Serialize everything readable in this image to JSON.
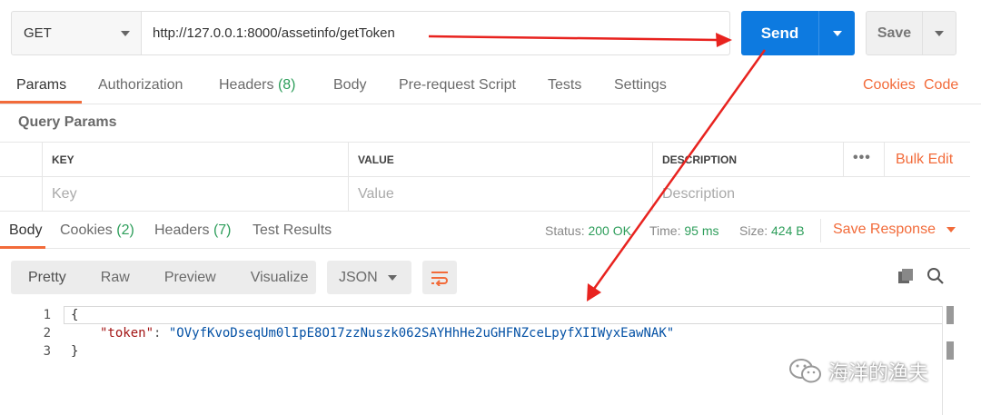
{
  "request": {
    "method": "GET",
    "url": "http://127.0.0.1:8000/assetinfo/getToken",
    "send_label": "Send",
    "save_label": "Save"
  },
  "request_tabs": {
    "params": "Params",
    "authorization": "Authorization",
    "headers": "Headers",
    "headers_count": "(8)",
    "body": "Body",
    "pre_request": "Pre-request Script",
    "tests": "Tests",
    "settings": "Settings",
    "cookies": "Cookies",
    "code": "Code"
  },
  "query_params": {
    "title": "Query Params",
    "columns": [
      "KEY",
      "VALUE",
      "DESCRIPTION"
    ],
    "placeholders": [
      "Key",
      "Value",
      "Description"
    ],
    "more": "•••",
    "bulk_edit": "Bulk Edit"
  },
  "response_tabs": {
    "body": "Body",
    "cookies": "Cookies",
    "cookies_count": "(2)",
    "headers": "Headers",
    "headers_count": "(7)",
    "test_results": "Test Results",
    "status_label": "Status:",
    "status_value": "200 OK",
    "time_label": "Time:",
    "time_value": "95 ms",
    "size_label": "Size:",
    "size_value": "424 B",
    "save_response": "Save Response"
  },
  "format_bar": {
    "pretty": "Pretty",
    "raw": "Raw",
    "preview": "Preview",
    "visualize": "Visualize",
    "format": "JSON"
  },
  "code": {
    "line_numbers": [
      "1",
      "2",
      "3"
    ],
    "open_brace": "{",
    "key": "\"token\"",
    "colon": ": ",
    "value": "\"OVyfKvoDseqUm0lIpE8O17zzNuszk062SAYHhHe2uGHFNZceLpyfXIIWyxEawNAK\"",
    "close_brace": "}"
  },
  "watermark": "海洋的渔夫",
  "colors": {
    "accent": "#f26b3a",
    "send_blue": "#0d7ae0",
    "success": "#2e9e5b",
    "arrow_red": "#e8231f"
  }
}
